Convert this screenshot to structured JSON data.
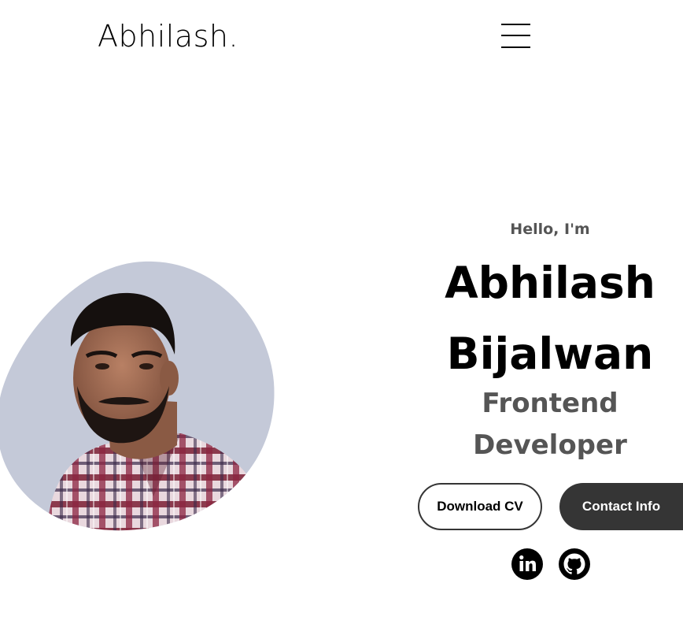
{
  "nav": {
    "logo": "Abhilash.",
    "menu_icon": "hamburger-menu-icon"
  },
  "profile": {
    "image_alt": "profile picture",
    "blob_color": "#c4c9d8"
  },
  "hero": {
    "greeting": "Hello, I'm",
    "name_line1": "Abhilash",
    "name_line2": "Bijalwan",
    "title_line1": "Frontend",
    "title_line2": "Developer"
  },
  "buttons": {
    "download_cv": "Download CV",
    "contact_info": "Contact Info"
  },
  "socials": [
    {
      "icon": "linkedin-icon"
    },
    {
      "icon": "github-icon"
    }
  ],
  "colors": {
    "text_primary": "#000000",
    "text_secondary": "#555555",
    "button_dark": "#353535"
  }
}
